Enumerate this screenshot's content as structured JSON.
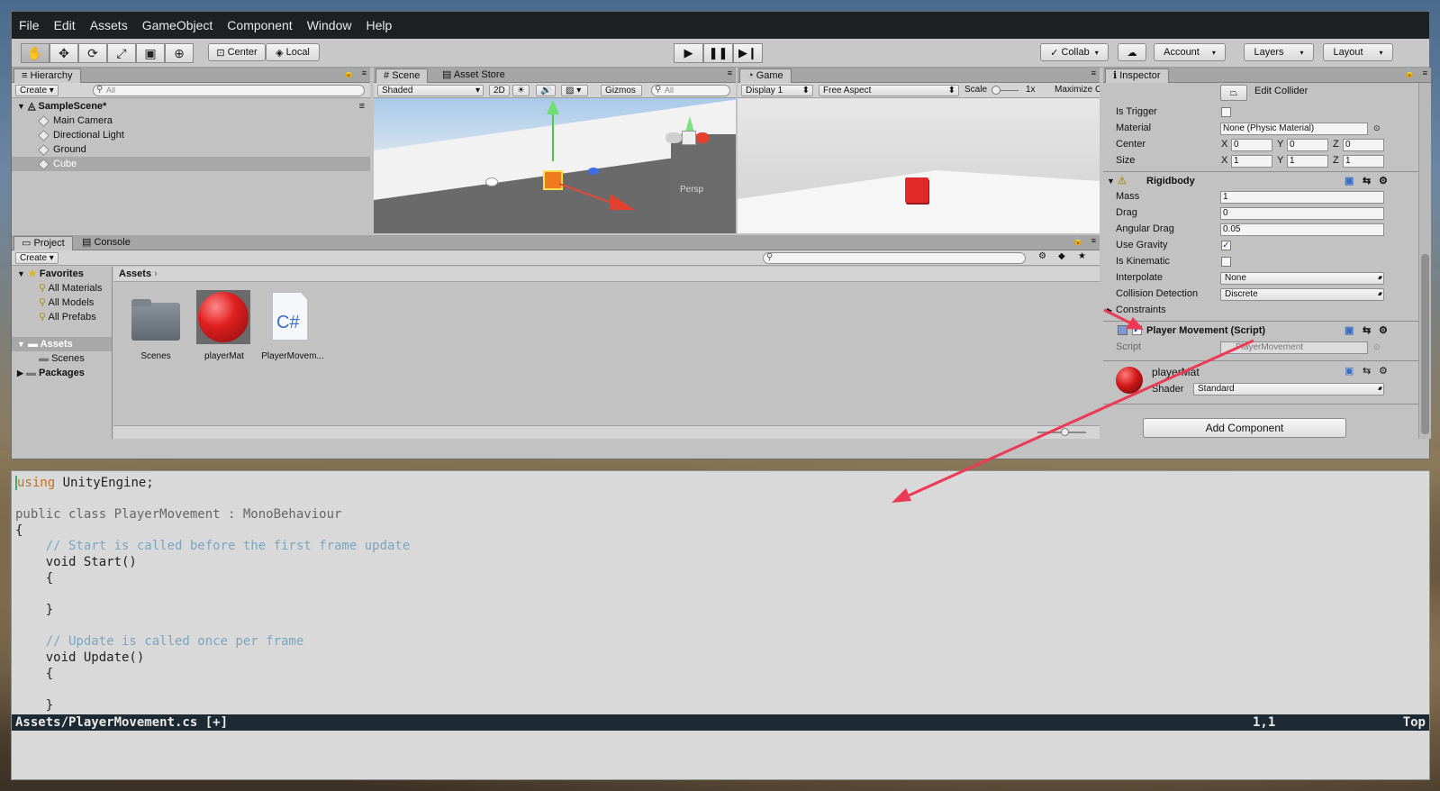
{
  "menubar": [
    "File",
    "Edit",
    "Assets",
    "GameObject",
    "Component",
    "Window",
    "Help"
  ],
  "toolbar": {
    "tools": [
      "hand-icon",
      "move-icon",
      "rotate-icon",
      "scale-icon",
      "rect-icon",
      "transform-icon"
    ],
    "pivot": "Center",
    "space": "Local",
    "play": [
      "▶",
      "❚❚",
      "▶❙"
    ],
    "collab": "Collab",
    "account": "Account",
    "layers": "Layers",
    "layout": "Layout"
  },
  "hierarchy": {
    "tab": "Hierarchy",
    "create": "Create",
    "search_placeholder": "All",
    "scene": "SampleScene*",
    "items": [
      "Main Camera",
      "Directional Light",
      "Ground",
      "Cube"
    ]
  },
  "scene": {
    "tabs": [
      "Scene",
      "Asset Store"
    ],
    "shading": "Shaded",
    "mode2d": "2D",
    "gizmos": "Gizmos",
    "search_placeholder": "All",
    "persp": "Persp"
  },
  "game": {
    "tab": "Game",
    "display": "Display 1",
    "aspect": "Free Aspect",
    "scale_label": "Scale",
    "scale_value": "1x",
    "maximize": "Maximize O"
  },
  "project": {
    "tabs": [
      "Project",
      "Console"
    ],
    "create": "Create",
    "favorites": "Favorites",
    "fav_items": [
      "All Materials",
      "All Models",
      "All Prefabs"
    ],
    "tree": [
      "Assets",
      "Scenes",
      "Packages"
    ],
    "breadcrumb": "Assets",
    "assets": [
      "Scenes",
      "playerMat",
      "PlayerMovem..."
    ],
    "cs_glyph": "C#"
  },
  "inspector": {
    "tab": "Inspector",
    "edit_collider": "Edit Collider",
    "collider": {
      "is_trigger": "Is Trigger",
      "material_label": "Material",
      "material_value": "None (Physic Material)",
      "center_label": "Center",
      "center": [
        "0",
        "0",
        "0"
      ],
      "size_label": "Size",
      "size": [
        "1",
        "1",
        "1"
      ],
      "axes": [
        "X",
        "Y",
        "Z"
      ]
    },
    "rigidbody": {
      "title": "Rigidbody",
      "mass_label": "Mass",
      "mass": "1",
      "drag_label": "Drag",
      "drag": "0",
      "angular_label": "Angular Drag",
      "angular": "0.05",
      "gravity_label": "Use Gravity",
      "kinematic_label": "Is Kinematic",
      "interp_label": "Interpolate",
      "interp": "None",
      "collision_label": "Collision Detection",
      "collision": "Discrete",
      "constraints_label": "Constraints"
    },
    "script_comp": {
      "title": "Player Movement (Script)",
      "script_label": "Script",
      "script_value": "PlayerMovement"
    },
    "material": {
      "name": "playerMat",
      "shader_label": "Shader",
      "shader": "Standard"
    },
    "add_component": "Add Component"
  },
  "editor": {
    "lines": [
      {
        "k": "using",
        "r": " UnityEngine;"
      },
      {
        "t": ""
      },
      {
        "t": "public class PlayerMovement : MonoBehaviour"
      },
      {
        "t": "{"
      },
      {
        "c": "    // Start is called before the first frame update"
      },
      {
        "t": "    void Start()"
      },
      {
        "t": "    {"
      },
      {
        "t": ""
      },
      {
        "t": "    }"
      },
      {
        "t": ""
      },
      {
        "c": "    // Update is called once per frame"
      },
      {
        "t": "    void Update()"
      },
      {
        "t": "    {"
      },
      {
        "t": ""
      },
      {
        "t": "    }"
      }
    ],
    "status_file": "Assets/PlayerMovement.cs [+]",
    "status_pos": "1,1",
    "status_scroll": "Top"
  },
  "colors": {
    "accent_arrow": "#ea3a55",
    "selection": "#a8a8a8",
    "cube_red": "#e02a2a"
  }
}
